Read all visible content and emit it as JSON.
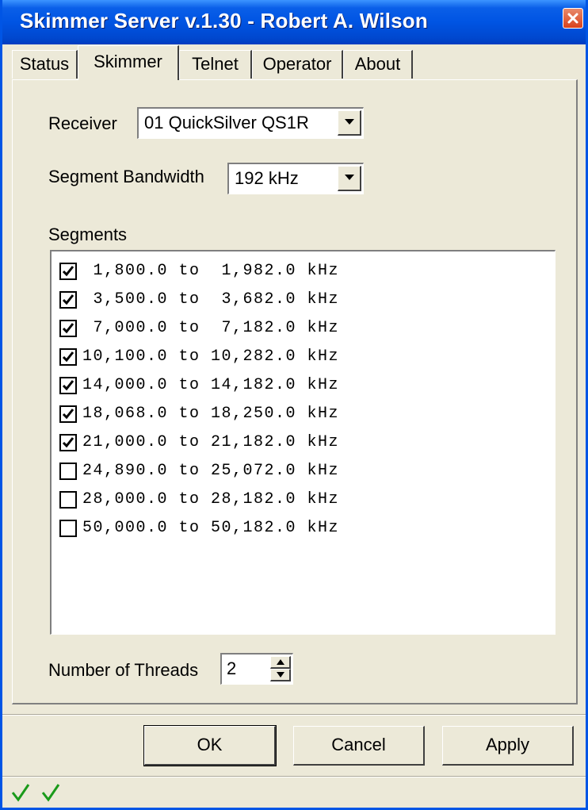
{
  "window": {
    "title": "Skimmer Server v.1.30 - Robert A. Wilson",
    "close_icon": "close-icon"
  },
  "tabs": [
    {
      "label": "Status",
      "active": false
    },
    {
      "label": "Skimmer",
      "active": true
    },
    {
      "label": "Telnet",
      "active": false
    },
    {
      "label": "Operator",
      "active": false
    },
    {
      "label": "About",
      "active": false
    }
  ],
  "skimmer": {
    "receiver_label": "Receiver",
    "receiver_value": "01 QuickSilver QS1R",
    "bandwidth_label": "Segment Bandwidth",
    "bandwidth_value": "192 kHz",
    "segments_label": "Segments",
    "segments": [
      {
        "text": " 1,800.0 to  1,982.0 kHz",
        "checked": true
      },
      {
        "text": " 3,500.0 to  3,682.0 kHz",
        "checked": true
      },
      {
        "text": " 7,000.0 to  7,182.0 kHz",
        "checked": true
      },
      {
        "text": "10,100.0 to 10,282.0 kHz",
        "checked": true
      },
      {
        "text": "14,000.0 to 14,182.0 kHz",
        "checked": true
      },
      {
        "text": "18,068.0 to 18,250.0 kHz",
        "checked": true
      },
      {
        "text": "21,000.0 to 21,182.0 kHz",
        "checked": true
      },
      {
        "text": "24,890.0 to 25,072.0 kHz",
        "checked": false
      },
      {
        "text": "28,000.0 to 28,182.0 kHz",
        "checked": false
      },
      {
        "text": "50,000.0 to 50,182.0 kHz",
        "checked": false
      }
    ],
    "threads_label": "Number of Threads",
    "threads_value": "2"
  },
  "buttons": {
    "ok": "OK",
    "cancel": "Cancel",
    "apply": "Apply"
  },
  "statusbar": {
    "indicators": [
      "check-icon",
      "check-icon"
    ],
    "indicator_color": "#1a9a1a"
  }
}
